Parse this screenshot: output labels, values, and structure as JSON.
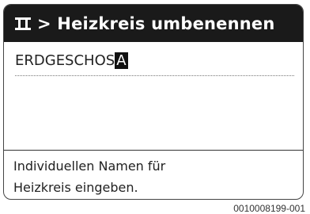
{
  "header": {
    "menu_icon": "menu-icon",
    "title": "> Heizkreis umbenennen"
  },
  "editor": {
    "value": "ERDGESCHOS",
    "cursor_char": "A"
  },
  "help": {
    "line1": "Individuellen Namen für",
    "line2": "Heizkreis eingeben."
  },
  "reference_number": "0010008199-001"
}
